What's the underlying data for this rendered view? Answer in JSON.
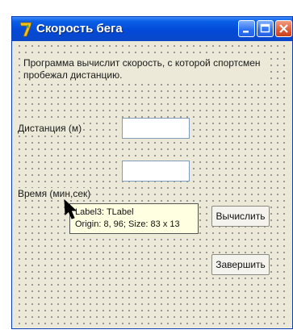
{
  "window": {
    "title": "Скорость бега",
    "icon": "delphi-7-icon",
    "controls": [
      "minimize-icon",
      "maximize-icon",
      "close-icon"
    ],
    "title_bar_color": "#0349d8",
    "form_color": "#ece9d8"
  },
  "form": {
    "description": "Программа вычислит скорость, с которой спортсмен пробежал дистанцию.",
    "distance_label": "Дистанция (м)",
    "distance_value": "",
    "time_label": "Время (мин,сек)",
    "time_value": "",
    "calculate_button": "Вычислить",
    "finish_button": "Завершить"
  },
  "hint": {
    "line1": "Label3: TLabel",
    "line2": "Origin: 8, 96; Size: 83 x 13",
    "background": "#ffffe1"
  },
  "cursor": "arrow-cursor-icon"
}
